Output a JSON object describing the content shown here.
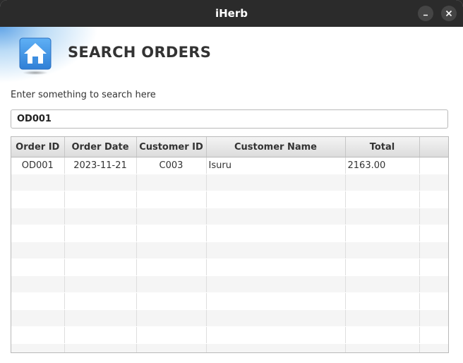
{
  "window": {
    "title": "iHerb",
    "minimize_icon": "minimize-icon",
    "close_icon": "close-icon"
  },
  "header": {
    "icon": "home-icon",
    "title": "SEARCH ORDERS"
  },
  "search": {
    "label": "Enter something to search here",
    "value": "OD001"
  },
  "table": {
    "columns": [
      "Order ID",
      "Order Date",
      "Customer ID",
      "Customer Name",
      "Total"
    ],
    "rows": [
      {
        "order_id": "OD001",
        "order_date": "2023-11-21",
        "customer_id": "C003",
        "customer_name": "Isuru",
        "total": "2163.00"
      }
    ]
  },
  "colors": {
    "titlebar": "#2b2b2b",
    "accent_blue": "#3d8ee0",
    "row_stripe": "#f5f5f5"
  }
}
